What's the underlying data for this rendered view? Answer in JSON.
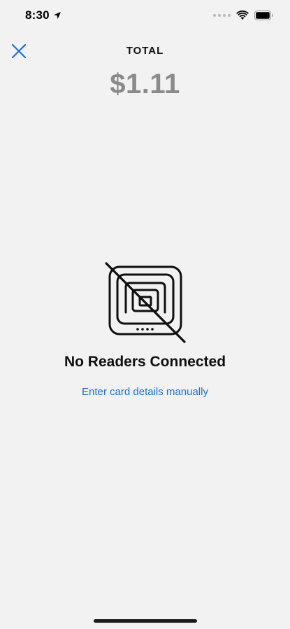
{
  "status_bar": {
    "time": "8:30",
    "location_icon": "location-arrow-icon",
    "signal_icon": "cellular-signal-icon",
    "wifi_icon": "wifi-icon",
    "battery_icon": "battery-icon"
  },
  "header": {
    "close_icon": "close-icon",
    "total_label": "TOTAL",
    "total_amount": "$1.11"
  },
  "main": {
    "reader_icon": "card-reader-disconnected-icon",
    "status_title": "No Readers Connected",
    "manual_entry_link": "Enter card details manually"
  },
  "colors": {
    "background": "#f2f2f2",
    "accent_blue": "#1c6fd9",
    "amount_gray": "#8a8a8a",
    "text_dark": "#111111"
  }
}
